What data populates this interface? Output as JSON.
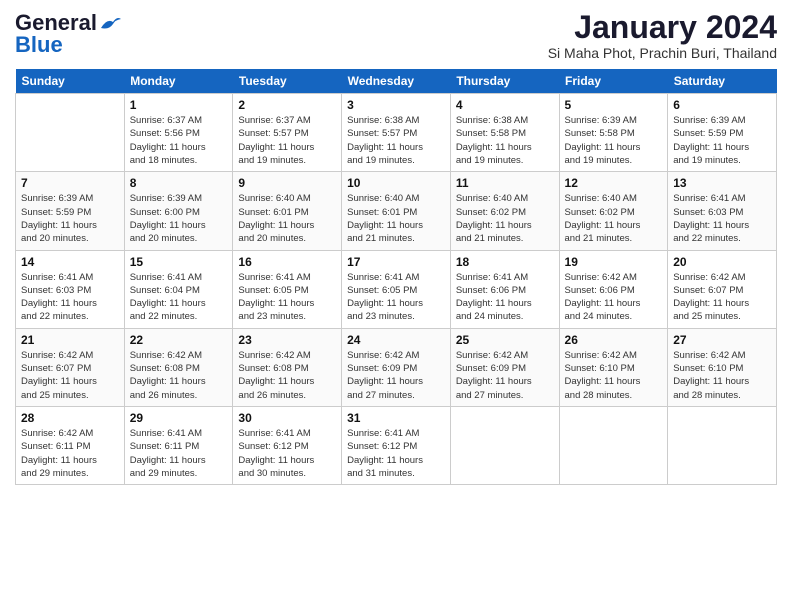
{
  "header": {
    "logo_line1": "General",
    "logo_line2": "Blue",
    "main_title": "January 2024",
    "subtitle": "Si Maha Phot, Prachin Buri, Thailand"
  },
  "calendar": {
    "days_of_week": [
      "Sunday",
      "Monday",
      "Tuesday",
      "Wednesday",
      "Thursday",
      "Friday",
      "Saturday"
    ],
    "weeks": [
      [
        {
          "day": "",
          "info": ""
        },
        {
          "day": "1",
          "info": "Sunrise: 6:37 AM\nSunset: 5:56 PM\nDaylight: 11 hours\nand 18 minutes."
        },
        {
          "day": "2",
          "info": "Sunrise: 6:37 AM\nSunset: 5:57 PM\nDaylight: 11 hours\nand 19 minutes."
        },
        {
          "day": "3",
          "info": "Sunrise: 6:38 AM\nSunset: 5:57 PM\nDaylight: 11 hours\nand 19 minutes."
        },
        {
          "day": "4",
          "info": "Sunrise: 6:38 AM\nSunset: 5:58 PM\nDaylight: 11 hours\nand 19 minutes."
        },
        {
          "day": "5",
          "info": "Sunrise: 6:39 AM\nSunset: 5:58 PM\nDaylight: 11 hours\nand 19 minutes."
        },
        {
          "day": "6",
          "info": "Sunrise: 6:39 AM\nSunset: 5:59 PM\nDaylight: 11 hours\nand 19 minutes."
        }
      ],
      [
        {
          "day": "7",
          "info": "Sunrise: 6:39 AM\nSunset: 5:59 PM\nDaylight: 11 hours\nand 20 minutes."
        },
        {
          "day": "8",
          "info": "Sunrise: 6:39 AM\nSunset: 6:00 PM\nDaylight: 11 hours\nand 20 minutes."
        },
        {
          "day": "9",
          "info": "Sunrise: 6:40 AM\nSunset: 6:01 PM\nDaylight: 11 hours\nand 20 minutes."
        },
        {
          "day": "10",
          "info": "Sunrise: 6:40 AM\nSunset: 6:01 PM\nDaylight: 11 hours\nand 21 minutes."
        },
        {
          "day": "11",
          "info": "Sunrise: 6:40 AM\nSunset: 6:02 PM\nDaylight: 11 hours\nand 21 minutes."
        },
        {
          "day": "12",
          "info": "Sunrise: 6:40 AM\nSunset: 6:02 PM\nDaylight: 11 hours\nand 21 minutes."
        },
        {
          "day": "13",
          "info": "Sunrise: 6:41 AM\nSunset: 6:03 PM\nDaylight: 11 hours\nand 22 minutes."
        }
      ],
      [
        {
          "day": "14",
          "info": "Sunrise: 6:41 AM\nSunset: 6:03 PM\nDaylight: 11 hours\nand 22 minutes."
        },
        {
          "day": "15",
          "info": "Sunrise: 6:41 AM\nSunset: 6:04 PM\nDaylight: 11 hours\nand 22 minutes."
        },
        {
          "day": "16",
          "info": "Sunrise: 6:41 AM\nSunset: 6:05 PM\nDaylight: 11 hours\nand 23 minutes."
        },
        {
          "day": "17",
          "info": "Sunrise: 6:41 AM\nSunset: 6:05 PM\nDaylight: 11 hours\nand 23 minutes."
        },
        {
          "day": "18",
          "info": "Sunrise: 6:41 AM\nSunset: 6:06 PM\nDaylight: 11 hours\nand 24 minutes."
        },
        {
          "day": "19",
          "info": "Sunrise: 6:42 AM\nSunset: 6:06 PM\nDaylight: 11 hours\nand 24 minutes."
        },
        {
          "day": "20",
          "info": "Sunrise: 6:42 AM\nSunset: 6:07 PM\nDaylight: 11 hours\nand 25 minutes."
        }
      ],
      [
        {
          "day": "21",
          "info": "Sunrise: 6:42 AM\nSunset: 6:07 PM\nDaylight: 11 hours\nand 25 minutes."
        },
        {
          "day": "22",
          "info": "Sunrise: 6:42 AM\nSunset: 6:08 PM\nDaylight: 11 hours\nand 26 minutes."
        },
        {
          "day": "23",
          "info": "Sunrise: 6:42 AM\nSunset: 6:08 PM\nDaylight: 11 hours\nand 26 minutes."
        },
        {
          "day": "24",
          "info": "Sunrise: 6:42 AM\nSunset: 6:09 PM\nDaylight: 11 hours\nand 27 minutes."
        },
        {
          "day": "25",
          "info": "Sunrise: 6:42 AM\nSunset: 6:09 PM\nDaylight: 11 hours\nand 27 minutes."
        },
        {
          "day": "26",
          "info": "Sunrise: 6:42 AM\nSunset: 6:10 PM\nDaylight: 11 hours\nand 28 minutes."
        },
        {
          "day": "27",
          "info": "Sunrise: 6:42 AM\nSunset: 6:10 PM\nDaylight: 11 hours\nand 28 minutes."
        }
      ],
      [
        {
          "day": "28",
          "info": "Sunrise: 6:42 AM\nSunset: 6:11 PM\nDaylight: 11 hours\nand 29 minutes."
        },
        {
          "day": "29",
          "info": "Sunrise: 6:41 AM\nSunset: 6:11 PM\nDaylight: 11 hours\nand 29 minutes."
        },
        {
          "day": "30",
          "info": "Sunrise: 6:41 AM\nSunset: 6:12 PM\nDaylight: 11 hours\nand 30 minutes."
        },
        {
          "day": "31",
          "info": "Sunrise: 6:41 AM\nSunset: 6:12 PM\nDaylight: 11 hours\nand 31 minutes."
        },
        {
          "day": "",
          "info": ""
        },
        {
          "day": "",
          "info": ""
        },
        {
          "day": "",
          "info": ""
        }
      ]
    ]
  }
}
